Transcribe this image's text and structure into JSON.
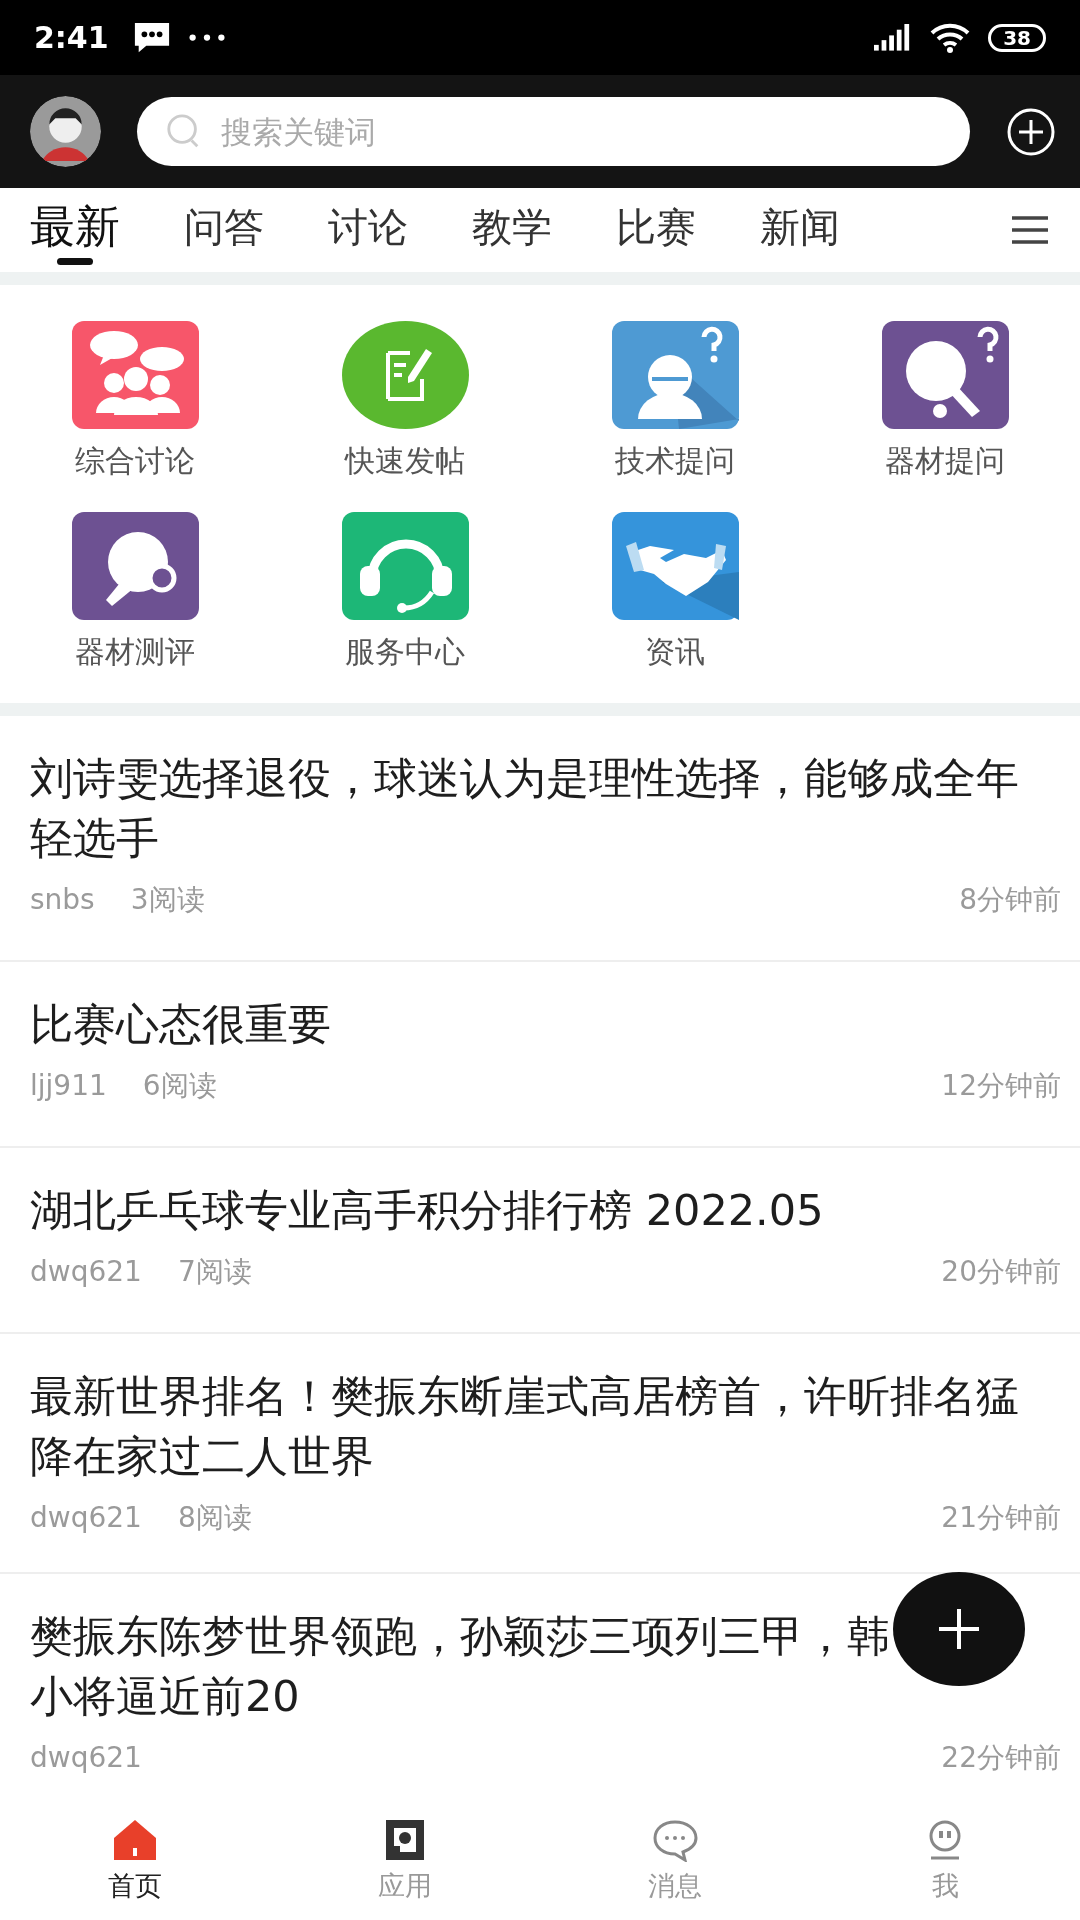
{
  "status_bar": {
    "time": "2:41",
    "battery": "38"
  },
  "search": {
    "placeholder": "搜索关键词"
  },
  "tabs": [
    {
      "label": "最新",
      "selected": true
    },
    {
      "label": "问答",
      "selected": false
    },
    {
      "label": "讨论",
      "selected": false
    },
    {
      "label": "教学",
      "selected": false
    },
    {
      "label": "比赛",
      "selected": false
    },
    {
      "label": "新闻",
      "selected": false
    }
  ],
  "shortcuts": [
    {
      "label": "综合讨论"
    },
    {
      "label": "快速发帖"
    },
    {
      "label": "技术提问"
    },
    {
      "label": "器材提问"
    },
    {
      "label": "器材测评"
    },
    {
      "label": "服务中心"
    },
    {
      "label": "资讯"
    }
  ],
  "posts": [
    {
      "title": "刘诗雯选择退役，球迷认为是理性选择，能够成全年轻选手",
      "author": "snbs",
      "reads": "3阅读",
      "time": "8分钟前"
    },
    {
      "title": "比赛心态很重要",
      "author": "ljj911",
      "reads": "6阅读",
      "time": "12分钟前"
    },
    {
      "title": "湖北乒乓球专业高手积分排行榜 2022.05",
      "author": "dwq621",
      "reads": "7阅读",
      "time": "20分钟前"
    },
    {
      "title": "最新世界排名！樊振东断崖式高居榜首，许昕排名猛降在家过二人世界",
      "author": "dwq621",
      "reads": "8阅读",
      "time": "21分钟前"
    },
    {
      "title": "樊振东陈梦世界领跑，孙颖莎三项列三甲，韩",
      "title_line_2": "小将逼近前20",
      "author": "dwq621",
      "time": "22分钟前"
    }
  ],
  "bottom_nav": [
    {
      "label": "首页",
      "selected": true
    },
    {
      "label": "应用",
      "selected": false
    },
    {
      "label": "消息",
      "selected": false
    },
    {
      "label": "我",
      "selected": false
    }
  ]
}
